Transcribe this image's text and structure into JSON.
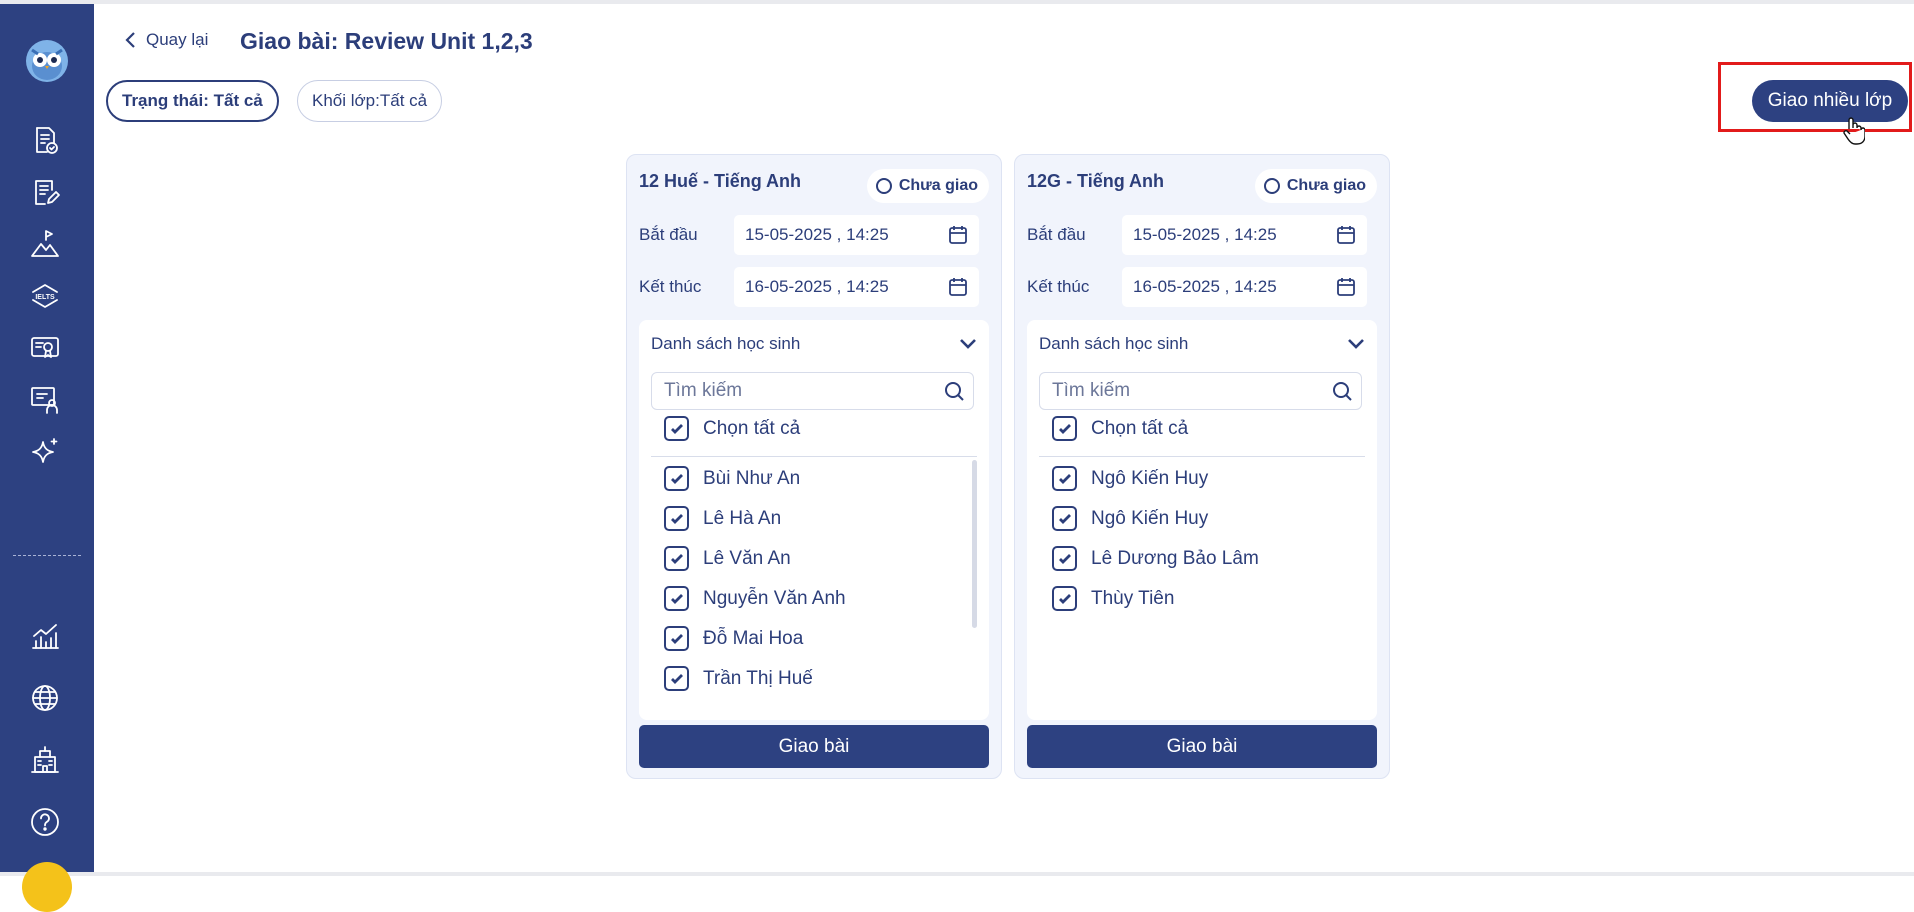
{
  "header": {
    "back_label": "Quay lại",
    "title": "Giao bài: Review Unit 1,2,3"
  },
  "filters": {
    "status": "Trạng thái: Tất cả",
    "grade": "Khối lớp:Tất cả"
  },
  "multi_assign_label": "Giao nhiều lớp",
  "sidebar": {
    "icons": [
      "owl-logo",
      "assignment-check-icon",
      "document-edit-icon",
      "mountain-flag-icon",
      "ielts-icon",
      "certificate-icon",
      "teacher-board-icon",
      "sparkle-ai-icon",
      "chart-growth-icon",
      "globe-icon",
      "school-building-icon",
      "help-icon"
    ]
  },
  "classes": [
    {
      "name": "12 Huế - Tiếng Anh",
      "status": "Chưa giao",
      "start_label": "Bắt đầu",
      "start_value": "15-05-2025 , 14:25",
      "end_label": "Kết thúc",
      "end_value": "16-05-2025 , 14:25",
      "list_title": "Danh sách học sinh",
      "search_placeholder": "Tìm kiếm",
      "select_all": "Chọn tất cả",
      "students": [
        "Bùi Như An",
        "Lê Hà An",
        "Lê Văn An",
        "Nguyễn Văn Anh",
        "Đỗ Mai Hoa",
        "Trần Thị Huế"
      ],
      "assign_label": "Giao bài"
    },
    {
      "name": "12G - Tiếng Anh",
      "status": "Chưa giao",
      "start_label": "Bắt đầu",
      "start_value": "15-05-2025 , 14:25",
      "end_label": "Kết thúc",
      "end_value": "16-05-2025 , 14:25",
      "list_title": "Danh sách học sinh",
      "search_placeholder": "Tìm kiếm",
      "select_all": "Chọn tất cả",
      "students": [
        "Ngô Kiến Huy",
        "Ngô Kiến Huy",
        "Lê Dương Bảo Lâm",
        "Thùy Tiên"
      ],
      "assign_label": "Giao bài"
    }
  ],
  "colors": {
    "primary": "#2d4181",
    "highlight": "#e21b1b",
    "card_bg": "#f1f4fc"
  }
}
